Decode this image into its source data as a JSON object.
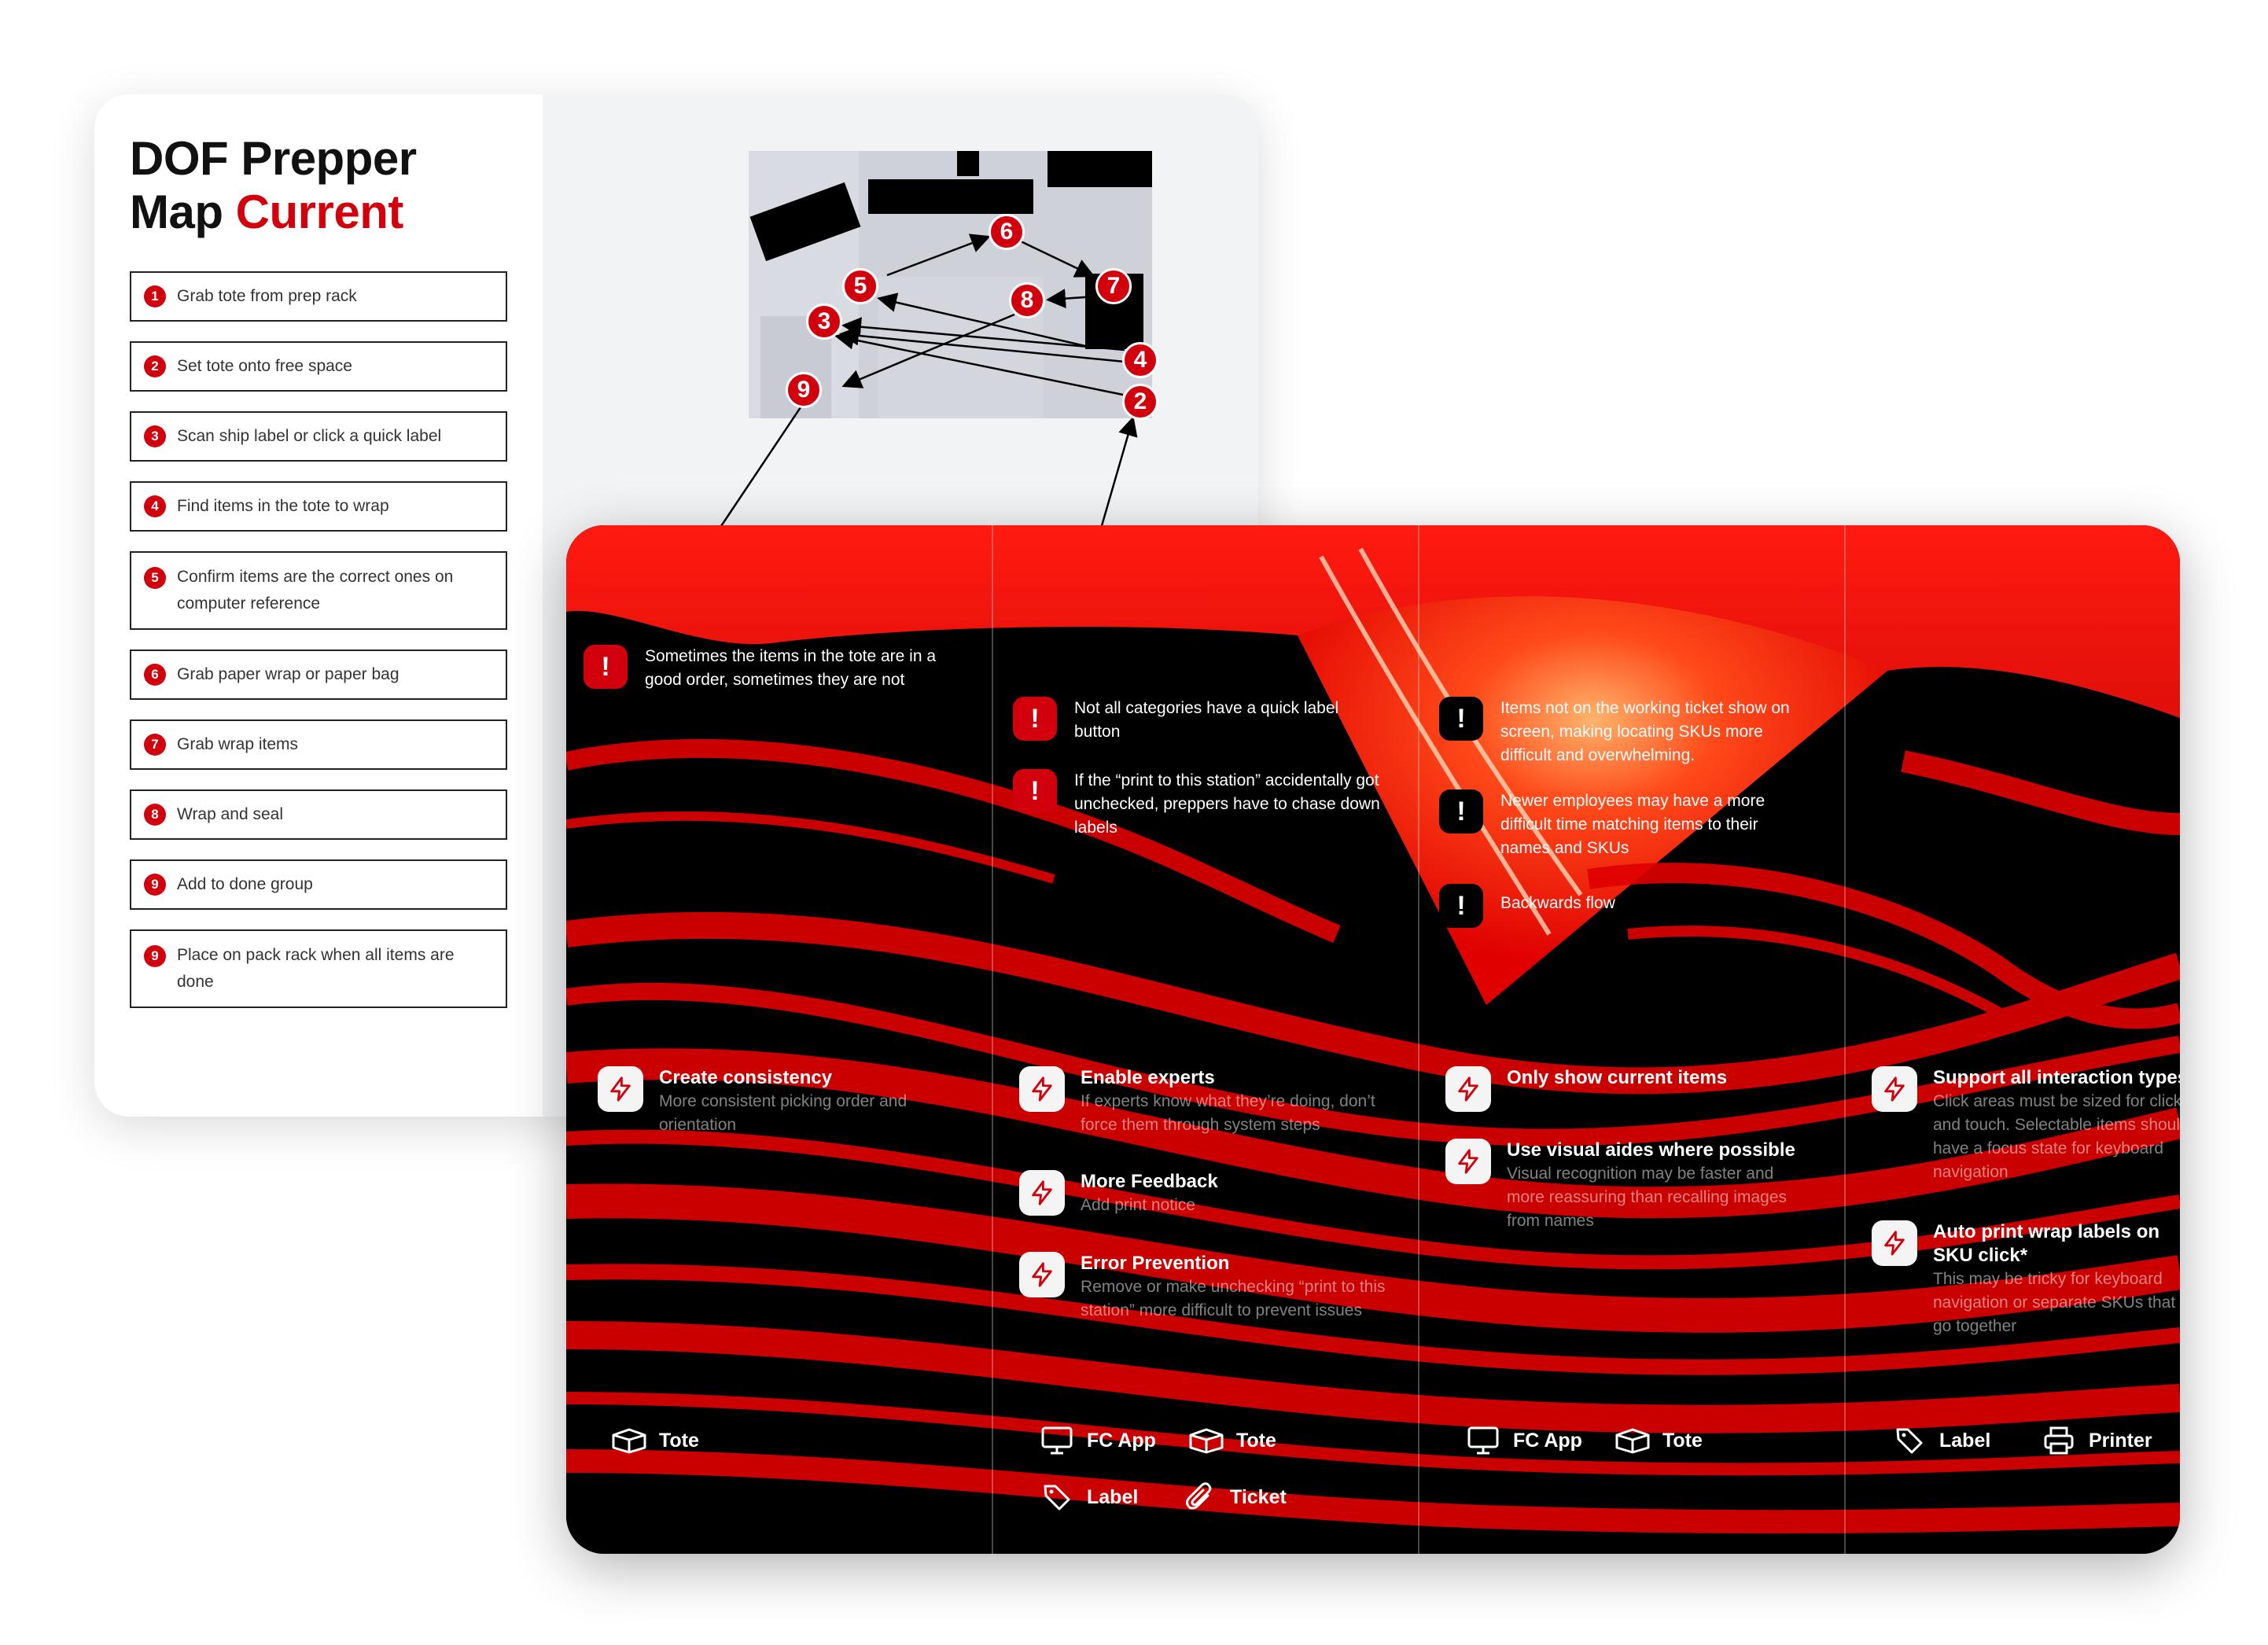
{
  "title": {
    "line1": "DOF Prepper",
    "line2_prefix": "Map ",
    "line2_accent": "Current"
  },
  "steps": [
    {
      "num": "1",
      "text": "Grab tote from prep rack"
    },
    {
      "num": "2",
      "text": "Set tote onto free space"
    },
    {
      "num": "3",
      "text": "Scan ship label or click a quick label"
    },
    {
      "num": "4",
      "text": "Find items in the tote to wrap"
    },
    {
      "num": "5",
      "text": "Confirm items are the correct ones on computer reference"
    },
    {
      "num": "6",
      "text": "Grab paper wrap or paper bag"
    },
    {
      "num": "7",
      "text": "Grab wrap items"
    },
    {
      "num": "8",
      "text": "Wrap and seal"
    },
    {
      "num": "9",
      "text": "Add to done group"
    },
    {
      "num": "9",
      "text": "Place on pack rack when all items are done"
    }
  ],
  "map_pins": [
    "6",
    "5",
    "8",
    "7",
    "3",
    "4",
    "9",
    "2"
  ],
  "columns": [
    {
      "issues": [
        {
          "icon": "!",
          "text": "Sometimes the items in the tote are in a good order, sometimes they are not"
        }
      ],
      "ideas": [
        {
          "title": "Create consistency",
          "body": "More consistent picking order and orientation"
        }
      ],
      "tags": [
        {
          "label": "Tote",
          "icon": "box-icon"
        }
      ]
    },
    {
      "issues": [
        {
          "icon": "!",
          "text": "Not all categories have a quick label button"
        },
        {
          "icon": "!",
          "text": "If the “print to this station” accidentally got unchecked, preppers have to chase down labels"
        }
      ],
      "ideas": [
        {
          "title": "Enable experts",
          "body": "If experts know what they’re doing, don’t force them through system steps"
        },
        {
          "title": "More Feedback",
          "body": "Add print notice"
        },
        {
          "title": "Error Prevention",
          "body": "Remove or make unchecking “print to this station” more difficult to prevent issues"
        }
      ],
      "tags": [
        {
          "label": "FC App",
          "icon": "monitor-icon"
        },
        {
          "label": "Tote",
          "icon": "box-icon"
        },
        {
          "label": "Label",
          "icon": "tag-icon"
        },
        {
          "label": "Ticket",
          "icon": "paperclip-icon"
        }
      ]
    },
    {
      "issues": [
        {
          "icon": "!",
          "text": "Items not on the working ticket show on screen, making locating SKUs more difficult and overwhelming."
        },
        {
          "icon": "!",
          "text": "Newer employees may have a more difficult time matching items to their names and SKUs"
        },
        {
          "icon": "!",
          "text": "Backwards flow"
        }
      ],
      "ideas": [
        {
          "title": "Only show current items",
          "body": ""
        },
        {
          "title": "Use visual aides where possible",
          "body": "Visual recognition may be faster and more reassuring than recalling images from names"
        }
      ],
      "tags": [
        {
          "label": "FC App",
          "icon": "monitor-icon"
        },
        {
          "label": "Tote",
          "icon": "box-icon"
        }
      ]
    },
    {
      "issues": [],
      "ideas": [
        {
          "title": "Support all interaction types",
          "body": "Click areas must be sized for click and touch. Selectable items should have a focus state for keyboard navigation"
        },
        {
          "title": "Auto print wrap labels on SKU click*",
          "body": "This may be tricky for keyboard navigation or separate SKUs that go together"
        }
      ],
      "tags": [
        {
          "label": "Label",
          "icon": "tag-icon"
        },
        {
          "label": "Printer",
          "icon": "printer-icon"
        }
      ]
    }
  ],
  "colors": {
    "accent": "#d1000c",
    "dark": "#000000",
    "panel": "#f2f3f5"
  }
}
